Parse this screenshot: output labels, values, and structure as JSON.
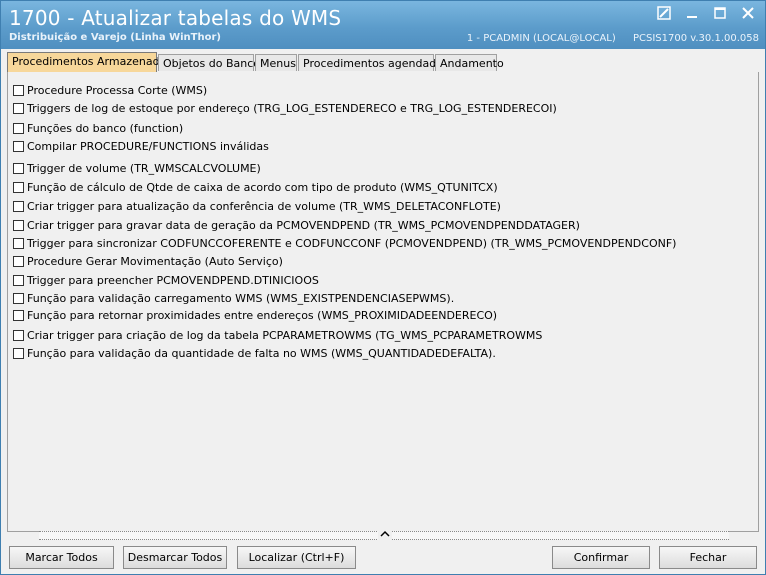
{
  "window": {
    "title": "1700 - Atualizar tabelas do WMS",
    "subtitle": "Distribuição e Varejo (Linha WinThor)",
    "user_info": "1 - PCADMIN (LOCAL@LOCAL)",
    "app_info": "PCSIS1700  v.30.1.00.058",
    "controls": [
      "edit-icon",
      "minimize-icon",
      "maximize-icon",
      "close-icon"
    ]
  },
  "tabs": [
    {
      "label": "Procedimentos Armazenados",
      "active": true
    },
    {
      "label": "Objetos do Banco",
      "active": false
    },
    {
      "label": "Menus",
      "active": false
    },
    {
      "label": "Procedimentos agendados",
      "active": false
    },
    {
      "label": "Andamento",
      "active": false
    }
  ],
  "items": [
    "Procedure Processa Corte (WMS)",
    "Triggers de log de estoque por endereço (TRG_LOG_ESTENDERECO e TRG_LOG_ESTENDERECOI)",
    "Funções do banco (function)",
    "Compilar PROCEDURE/FUNCTIONS inválidas",
    "Trigger de volume (TR_WMSCALCVOLUME)",
    "Função de cálculo de Qtde de caixa de acordo com tipo de produto (WMS_QTUNITCX)",
    "Criar trigger para atualização da conferência de volume (TR_WMS_DELETACONFLOTE)",
    "Criar trigger para gravar data de geração da PCMOVENDPEND (TR_WMS_PCMOVENDPENDDATAGER)",
    "Trigger para sincronizar CODFUNCCOFERENTE e CODFUNCCONF (PCMOVENDPEND) (TR_WMS_PCMOVENDPENDCONF)",
    "Procedure Gerar Movimentação (Auto Serviço)",
    "Trigger para preencher PCMOVENDPEND.DTINICIOOS",
    "Função para validação carregamento WMS (WMS_EXISTPENDENCIASEPWMS).",
    "Função para retornar proximidades entre endereços (WMS_PROXIMIDADEENDERECO)",
    "Criar trigger para criação de log da tabela PCPARAMETROWMS (TG_WMS_PCPARAMETROWMS",
    "Função para validação da quantidade de falta no WMS (WMS_QUANTIDADEDEFALTA)."
  ],
  "buttons": {
    "select_all": "Marcar Todos",
    "deselect_all": "Desmarcar Todos",
    "find": "Localizar (Ctrl+F)",
    "confirm": "Confirmar",
    "close": "Fechar"
  }
}
